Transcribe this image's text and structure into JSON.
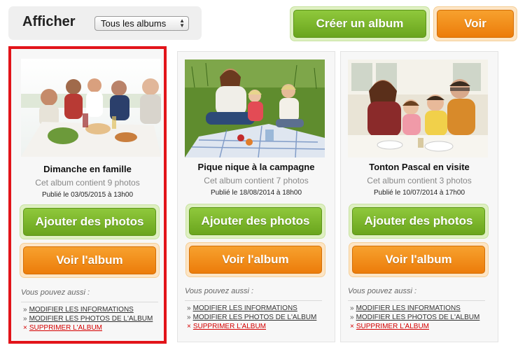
{
  "toolbar": {
    "show_label": "Afficher",
    "album_filter": {
      "selected": "Tous les albums"
    },
    "create_album_label": "Créer un album",
    "view_label": "Voir"
  },
  "albums": [
    {
      "title": "Dimanche en famille",
      "count_text": "Cet album contient 9 photos",
      "published": "Publié le 03/05/2015 à 13h00",
      "add_photos_label": "Ajouter des photos",
      "view_album_label": "Voir l'album",
      "also_label": "Vous pouvez aussi :",
      "link_edit_info": "MODIFIER LES INFORMATIONS",
      "link_edit_photos": "MODIFIER LES PHOTOS DE L'ALBUM",
      "link_delete": "SUPPRIMER L'ALBUM",
      "link_marker": "»",
      "delete_marker": "×",
      "selected": true
    },
    {
      "title": "Pique nique à la campagne",
      "count_text": "Cet album contient 7 photos",
      "published": "Publié le 18/08/2014 à 18h00",
      "add_photos_label": "Ajouter des photos",
      "view_album_label": "Voir l'album",
      "also_label": "Vous pouvez aussi :",
      "link_edit_info": "MODIFIER LES INFORMATIONS",
      "link_edit_photos": "MODIFIER LES PHOTOS DE L'ALBUM",
      "link_delete": "SUPPRIMER L'ALBUM",
      "link_marker": "»",
      "delete_marker": "×",
      "selected": false
    },
    {
      "title": "Tonton Pascal en visite",
      "count_text": "Cet album contient 3 photos",
      "published": "Publié le 10/07/2014 à 17h00",
      "add_photos_label": "Ajouter des photos",
      "view_album_label": "Voir l'album",
      "also_label": "Vous pouvez aussi :",
      "link_edit_info": "MODIFIER LES INFORMATIONS",
      "link_edit_photos": "MODIFIER LES PHOTOS DE L'ALBUM",
      "link_delete": "SUPPRIMER L'ALBUM",
      "link_marker": "»",
      "delete_marker": "×",
      "selected": false
    }
  ],
  "colors": {
    "green_button": "#6aa51d",
    "orange_button": "#ec7c0a",
    "selection_border": "#e2141a",
    "delete_link": "#d40000"
  }
}
